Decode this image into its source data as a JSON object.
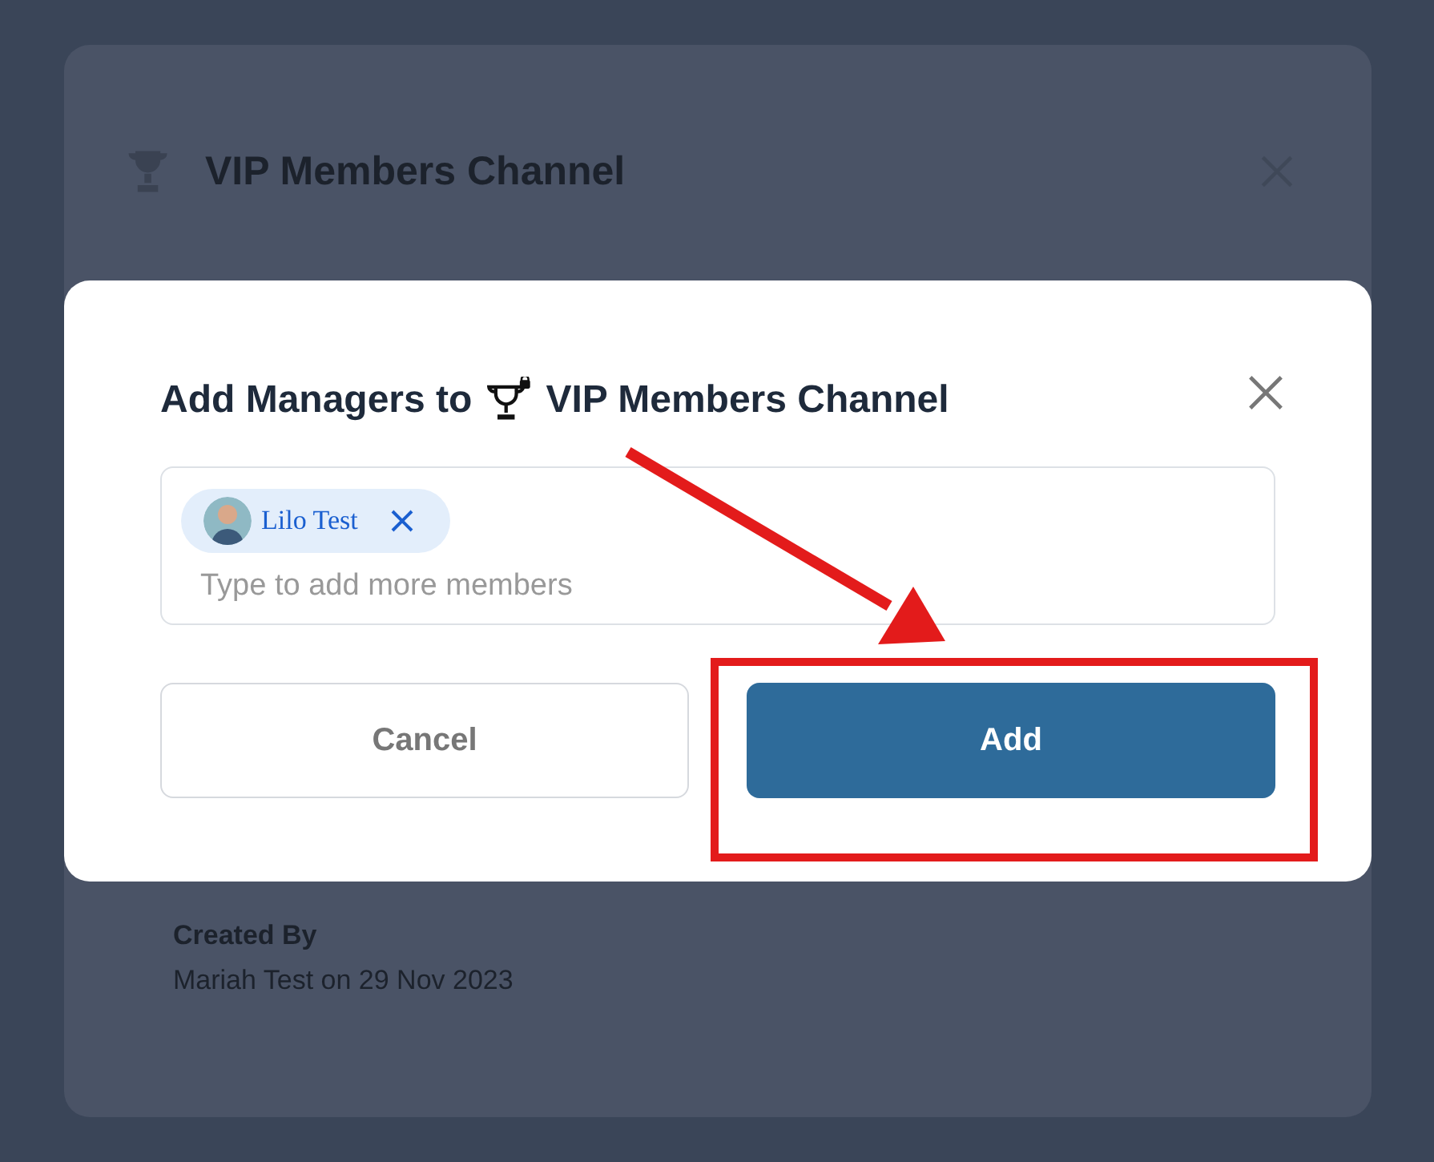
{
  "background_dialog": {
    "title": "VIP Members Channel",
    "created_by_label": "Created By",
    "created_by_value": "Mariah Test on 29 Nov 2023"
  },
  "modal": {
    "title_prefix": "Add Managers to",
    "title_channel": "VIP Members Channel",
    "members": [
      {
        "name": "Lilo Test"
      }
    ],
    "input": {
      "placeholder": "Type to add more members"
    },
    "buttons": [
      {
        "label": "Cancel",
        "kind": "secondary"
      },
      {
        "label": "Add",
        "kind": "primary"
      }
    ]
  }
}
